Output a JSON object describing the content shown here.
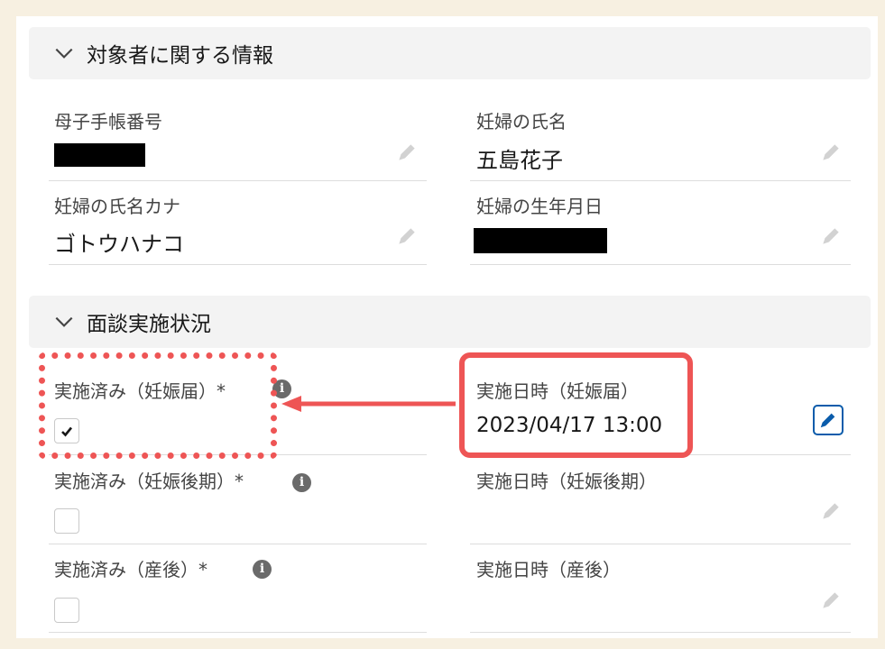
{
  "sections": [
    {
      "title": "対象者に関する情報",
      "fields": [
        {
          "label": "母子手帳番号",
          "value": "",
          "redacted": true
        },
        {
          "label": "妊婦の氏名",
          "value": "五島花子",
          "redacted": false
        },
        {
          "label": "妊婦の氏名カナ",
          "value": "ゴトウハナコ",
          "redacted": false
        },
        {
          "label": "妊婦の生年月日",
          "value": "",
          "redacted": true
        }
      ]
    },
    {
      "title": "面談実施状況",
      "fields": [
        {
          "label": "実施済み（妊娠届）*",
          "checked": true
        },
        {
          "label": "実施日時（妊娠届）",
          "value": "2023/04/17 13:00"
        },
        {
          "label": "実施済み（妊娠後期）*",
          "checked": false
        },
        {
          "label": "実施日時（妊娠後期）",
          "value": ""
        },
        {
          "label": "実施済み（産後）*",
          "checked": false
        },
        {
          "label": "実施日時（産後）",
          "value": ""
        }
      ]
    }
  ],
  "icons": {
    "chevron": "chevron-down-icon",
    "pencil": "pencil-icon",
    "info": "info-icon",
    "edit": "edit-button-icon",
    "check": "checkmark-icon"
  },
  "info_glyph": "i",
  "colors": {
    "page_background": "#f7f0e1",
    "panel": "#ffffff",
    "section_header": "#f3f3f3",
    "annotation": "#ee5555",
    "edit_button": "#0b5cab",
    "checkbox_check": "#181818",
    "info_icon": "#6a6a6a",
    "pencil_icon": "#c9c9c9"
  }
}
